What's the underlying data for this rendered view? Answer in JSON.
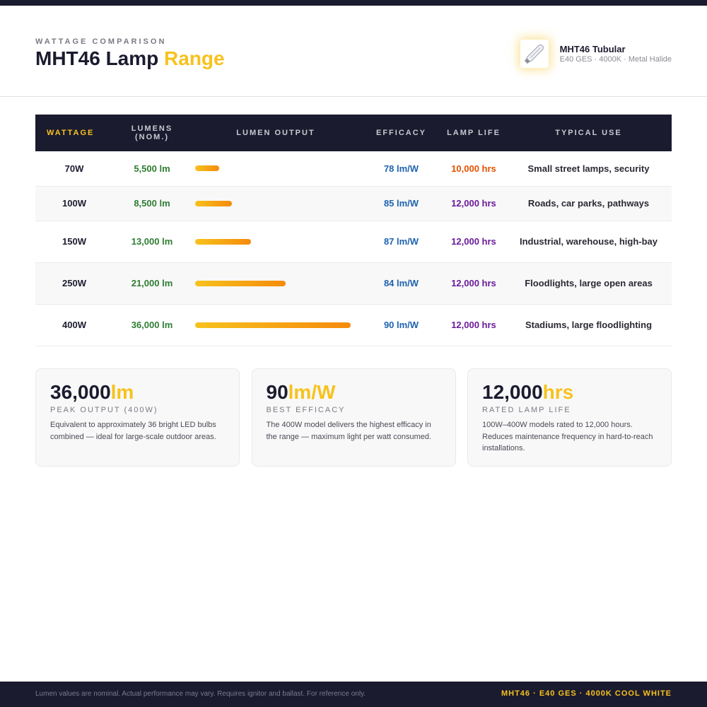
{
  "header": {
    "eyebrow": "WATTAGE COMPARISON",
    "title_main": "MHT46 Lamp",
    "title_accent": "Range",
    "product": {
      "icon": "tubular-lamp-icon",
      "name": "MHT46 Tubular",
      "spec": "E40 GES · 4000K · Metal Halide"
    }
  },
  "table": {
    "headers": {
      "wattage": "WATTAGE",
      "lumens": "LUMENS (NOM.)",
      "output": "LUMEN OUTPUT",
      "efficacy": "EFFICACY",
      "life": "LAMP LIFE",
      "use": "TYPICAL USE"
    },
    "rows": [
      {
        "wattage": "70W",
        "lumens": "5,500 lm",
        "lumen_value": 5500,
        "efficacy": "78 lm/W",
        "life": "10,000 hrs",
        "use": "Small street lamps, security"
      },
      {
        "wattage": "100W",
        "lumens": "8,500 lm",
        "lumen_value": 8500,
        "efficacy": "85 lm/W",
        "life": "12,000 hrs",
        "use": "Roads, car parks, pathways"
      },
      {
        "wattage": "150W",
        "lumens": "13,000 lm",
        "lumen_value": 13000,
        "efficacy": "87 lm/W",
        "life": "12,000 hrs",
        "use": "Industrial, warehouse, high-bay"
      },
      {
        "wattage": "250W",
        "lumens": "21,000 lm",
        "lumen_value": 21000,
        "efficacy": "84 lm/W",
        "life": "12,000 hrs",
        "use": "Floodlights, large open areas"
      },
      {
        "wattage": "400W",
        "lumens": "36,000 lm",
        "lumen_value": 36000,
        "efficacy": "90 lm/W",
        "life": "12,000 hrs",
        "use": "Stadiums, large floodlighting"
      }
    ]
  },
  "cards": [
    {
      "value": "36,000",
      "unit": "lm",
      "label": "PEAK OUTPUT (400W)",
      "desc": "Equivalent to approximately 36 bright LED bulbs combined — ideal for large-scale outdoor areas."
    },
    {
      "value": "90",
      "unit": "lm/W",
      "label": "BEST EFFICACY",
      "desc": "The 400W model delivers the highest efficacy in the range — maximum light per watt consumed."
    },
    {
      "value": "12,000",
      "unit": "hrs",
      "label": "RATED LAMP LIFE",
      "desc": "100W–400W models rated to 12,000 hours. Reduces maintenance frequency in hard-to-reach installations."
    }
  ],
  "footer": {
    "note": "Lumen values are nominal. Actual performance may vary. Requires ignitor and ballast. For reference only.",
    "brand": "MHT46 · E40 GES · 4000K COOL WHITE"
  },
  "colors": {
    "navy": "#1b1b2f",
    "accent": "#f7c21d",
    "lumens_green": "#2e7d32",
    "efficacy_blue": "#1e63b0",
    "life_purple": "#6a1b9a",
    "life_orange": "#e65100"
  }
}
